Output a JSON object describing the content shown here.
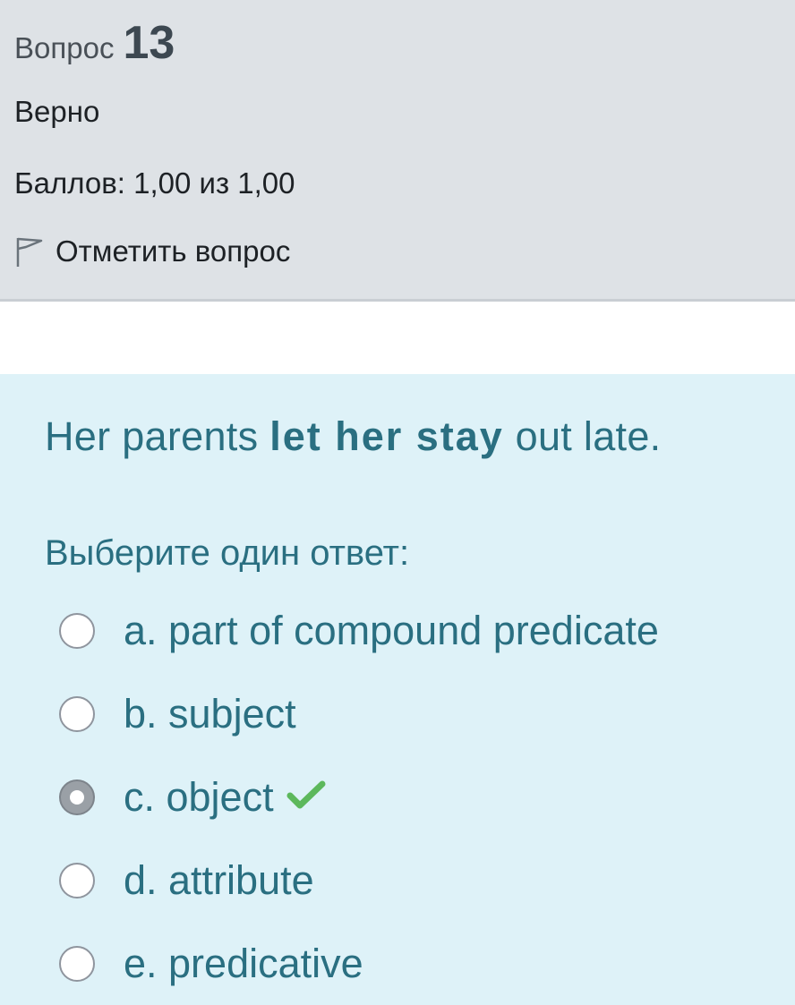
{
  "info": {
    "question_word": "Вопрос",
    "question_number": "13",
    "state": "Верно",
    "grade": "Баллов: 1,00 из 1,00",
    "flag_label": "Отметить вопрос"
  },
  "question": {
    "text_before": "Her parents ",
    "text_strong": "let her stay",
    "text_after": " out  late.",
    "prompt": "Выберите один ответ:",
    "answers": [
      {
        "label": "a. part of compound predicate",
        "selected": false
      },
      {
        "label": "b. subject",
        "selected": false
      },
      {
        "label": "c. object",
        "selected": true,
        "correct": true
      },
      {
        "label": "d. attribute",
        "selected": false
      },
      {
        "label": "e. predicative",
        "selected": false
      }
    ]
  },
  "colors": {
    "info_bg": "#dee2e6",
    "content_bg": "#def2f8",
    "question_text": "#2a6f81",
    "correct_check": "#5cb85c"
  },
  "icons": {
    "flag": "flag-icon",
    "correct": "check-icon"
  }
}
